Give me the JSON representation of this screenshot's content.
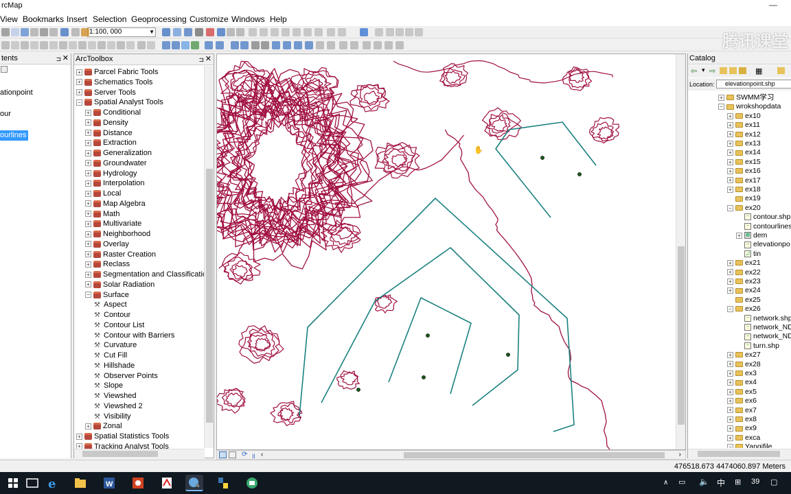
{
  "app": {
    "title": "rcMap"
  },
  "menu": [
    "View",
    "Bookmarks",
    "Insert",
    "Selection",
    "Geoprocessing",
    "Customize",
    "Windows",
    "Help"
  ],
  "toolbar": {
    "scale": "1:100, 000"
  },
  "toc": {
    "title": "tents",
    "items": [
      "ationpoint",
      "our",
      "ourlines"
    ],
    "selected_index": 2
  },
  "arctoolbox": {
    "title": "ArcToolbox",
    "items": [
      {
        "label": "Parcel Fabric Tools",
        "level": 0,
        "type": "toolbox",
        "expanded": false
      },
      {
        "label": "Schematics Tools",
        "level": 0,
        "type": "toolbox",
        "expanded": false
      },
      {
        "label": "Server Tools",
        "level": 0,
        "type": "toolbox",
        "expanded": false
      },
      {
        "label": "Spatial Analyst Tools",
        "level": 0,
        "type": "toolbox",
        "expanded": true
      },
      {
        "label": "Conditional",
        "level": 1,
        "type": "toolset",
        "expanded": false
      },
      {
        "label": "Density",
        "level": 1,
        "type": "toolset",
        "expanded": false
      },
      {
        "label": "Distance",
        "level": 1,
        "type": "toolset",
        "expanded": false
      },
      {
        "label": "Extraction",
        "level": 1,
        "type": "toolset",
        "expanded": false
      },
      {
        "label": "Generalization",
        "level": 1,
        "type": "toolset",
        "expanded": false
      },
      {
        "label": "Groundwater",
        "level": 1,
        "type": "toolset",
        "expanded": false
      },
      {
        "label": "Hydrology",
        "level": 1,
        "type": "toolset",
        "expanded": false
      },
      {
        "label": "Interpolation",
        "level": 1,
        "type": "toolset",
        "expanded": false
      },
      {
        "label": "Local",
        "level": 1,
        "type": "toolset",
        "expanded": false
      },
      {
        "label": "Map Algebra",
        "level": 1,
        "type": "toolset",
        "expanded": false
      },
      {
        "label": "Math",
        "level": 1,
        "type": "toolset",
        "expanded": false
      },
      {
        "label": "Multivariate",
        "level": 1,
        "type": "toolset",
        "expanded": false
      },
      {
        "label": "Neighborhood",
        "level": 1,
        "type": "toolset",
        "expanded": false
      },
      {
        "label": "Overlay",
        "level": 1,
        "type": "toolset",
        "expanded": false
      },
      {
        "label": "Raster Creation",
        "level": 1,
        "type": "toolset",
        "expanded": false
      },
      {
        "label": "Reclass",
        "level": 1,
        "type": "toolset",
        "expanded": false
      },
      {
        "label": "Segmentation and Classification",
        "level": 1,
        "type": "toolset",
        "expanded": false
      },
      {
        "label": "Solar Radiation",
        "level": 1,
        "type": "toolset",
        "expanded": false
      },
      {
        "label": "Surface",
        "level": 1,
        "type": "toolset",
        "expanded": true
      },
      {
        "label": "Aspect",
        "level": 2,
        "type": "tool"
      },
      {
        "label": "Contour",
        "level": 2,
        "type": "tool"
      },
      {
        "label": "Contour List",
        "level": 2,
        "type": "tool"
      },
      {
        "label": "Contour with Barriers",
        "level": 2,
        "type": "tool"
      },
      {
        "label": "Curvature",
        "level": 2,
        "type": "tool"
      },
      {
        "label": "Cut Fill",
        "level": 2,
        "type": "tool"
      },
      {
        "label": "Hillshade",
        "level": 2,
        "type": "tool"
      },
      {
        "label": "Observer Points",
        "level": 2,
        "type": "tool"
      },
      {
        "label": "Slope",
        "level": 2,
        "type": "tool"
      },
      {
        "label": "Viewshed",
        "level": 2,
        "type": "tool"
      },
      {
        "label": "Viewshed 2",
        "level": 2,
        "type": "tool"
      },
      {
        "label": "Visibility",
        "level": 2,
        "type": "tool"
      },
      {
        "label": "Zonal",
        "level": 1,
        "type": "toolset",
        "expanded": false
      },
      {
        "label": "Spatial Statistics Tools",
        "level": 0,
        "type": "toolbox",
        "expanded": false
      },
      {
        "label": "Tracking Analyst Tools",
        "level": 0,
        "type": "toolbox",
        "expanded": false
      }
    ]
  },
  "catalog": {
    "title": "Catalog",
    "location_label": "Location:",
    "location_value": "elevationpoint.shp",
    "items": [
      {
        "label": "SWMM学习",
        "level": 0,
        "type": "folder",
        "pm": "+"
      },
      {
        "label": "wrokshopdata",
        "level": 0,
        "type": "folder",
        "pm": "-"
      },
      {
        "label": "ex10",
        "level": 1,
        "type": "folder",
        "pm": "+"
      },
      {
        "label": "ex11",
        "level": 1,
        "type": "folder",
        "pm": "+"
      },
      {
        "label": "ex12",
        "level": 1,
        "type": "folder",
        "pm": "+"
      },
      {
        "label": "ex13",
        "level": 1,
        "type": "folder",
        "pm": "+"
      },
      {
        "label": "ex14",
        "level": 1,
        "type": "folder",
        "pm": "+"
      },
      {
        "label": "ex15",
        "level": 1,
        "type": "folder",
        "pm": "+"
      },
      {
        "label": "ex16",
        "level": 1,
        "type": "folder",
        "pm": "+"
      },
      {
        "label": "ex17",
        "level": 1,
        "type": "folder",
        "pm": "+"
      },
      {
        "label": "ex18",
        "level": 1,
        "type": "folder",
        "pm": "+"
      },
      {
        "label": "ex19",
        "level": 1,
        "type": "folder",
        "pm": ""
      },
      {
        "label": "ex20",
        "level": 1,
        "type": "folder",
        "pm": "-"
      },
      {
        "label": "contour.shp",
        "level": 2,
        "type": "shp",
        "pm": ""
      },
      {
        "label": "contourlines",
        "level": 2,
        "type": "shp",
        "pm": ""
      },
      {
        "label": "dem",
        "level": 2,
        "type": "raster",
        "pm": "+"
      },
      {
        "label": "elevationpo",
        "level": 2,
        "type": "shp",
        "pm": ""
      },
      {
        "label": "tin",
        "level": 2,
        "type": "tin",
        "pm": ""
      },
      {
        "label": "ex21",
        "level": 1,
        "type": "folder",
        "pm": "+"
      },
      {
        "label": "ex22",
        "level": 1,
        "type": "folder",
        "pm": "+"
      },
      {
        "label": "ex23",
        "level": 1,
        "type": "folder",
        "pm": "+"
      },
      {
        "label": "ex24",
        "level": 1,
        "type": "folder",
        "pm": "+"
      },
      {
        "label": "ex25",
        "level": 1,
        "type": "folder",
        "pm": ""
      },
      {
        "label": "ex26",
        "level": 1,
        "type": "folder",
        "pm": "-"
      },
      {
        "label": "network.shp",
        "level": 2,
        "type": "shp",
        "pm": ""
      },
      {
        "label": "network_ND",
        "level": 2,
        "type": "shp",
        "pm": ""
      },
      {
        "label": "network_ND",
        "level": 2,
        "type": "shp",
        "pm": ""
      },
      {
        "label": "turn.shp",
        "level": 2,
        "type": "shp",
        "pm": ""
      },
      {
        "label": "ex27",
        "level": 1,
        "type": "folder",
        "pm": "+"
      },
      {
        "label": "ex28",
        "level": 1,
        "type": "folder",
        "pm": "+"
      },
      {
        "label": "ex3",
        "level": 1,
        "type": "folder",
        "pm": "+"
      },
      {
        "label": "ex4",
        "level": 1,
        "type": "folder",
        "pm": "+"
      },
      {
        "label": "ex5",
        "level": 1,
        "type": "folder",
        "pm": "+"
      },
      {
        "label": "ex6",
        "level": 1,
        "type": "folder",
        "pm": "+"
      },
      {
        "label": "ex7",
        "level": 1,
        "type": "folder",
        "pm": "+"
      },
      {
        "label": "ex8",
        "level": 1,
        "type": "folder",
        "pm": "+"
      },
      {
        "label": "ex9",
        "level": 1,
        "type": "folder",
        "pm": "+"
      },
      {
        "label": "exca",
        "level": 1,
        "type": "folder",
        "pm": "+"
      },
      {
        "label": "Yangifile",
        "level": 1,
        "type": "folder",
        "pm": "-"
      }
    ]
  },
  "status": {
    "coords": "476518.673  4474060.897 Meters"
  },
  "watermark": "腾讯课堂",
  "taskbar": {
    "clock": "39"
  },
  "colors": {
    "contour": "#a01040",
    "lines": "#1a8080",
    "points": "#1a5a1a",
    "selection": "#3399ff"
  }
}
